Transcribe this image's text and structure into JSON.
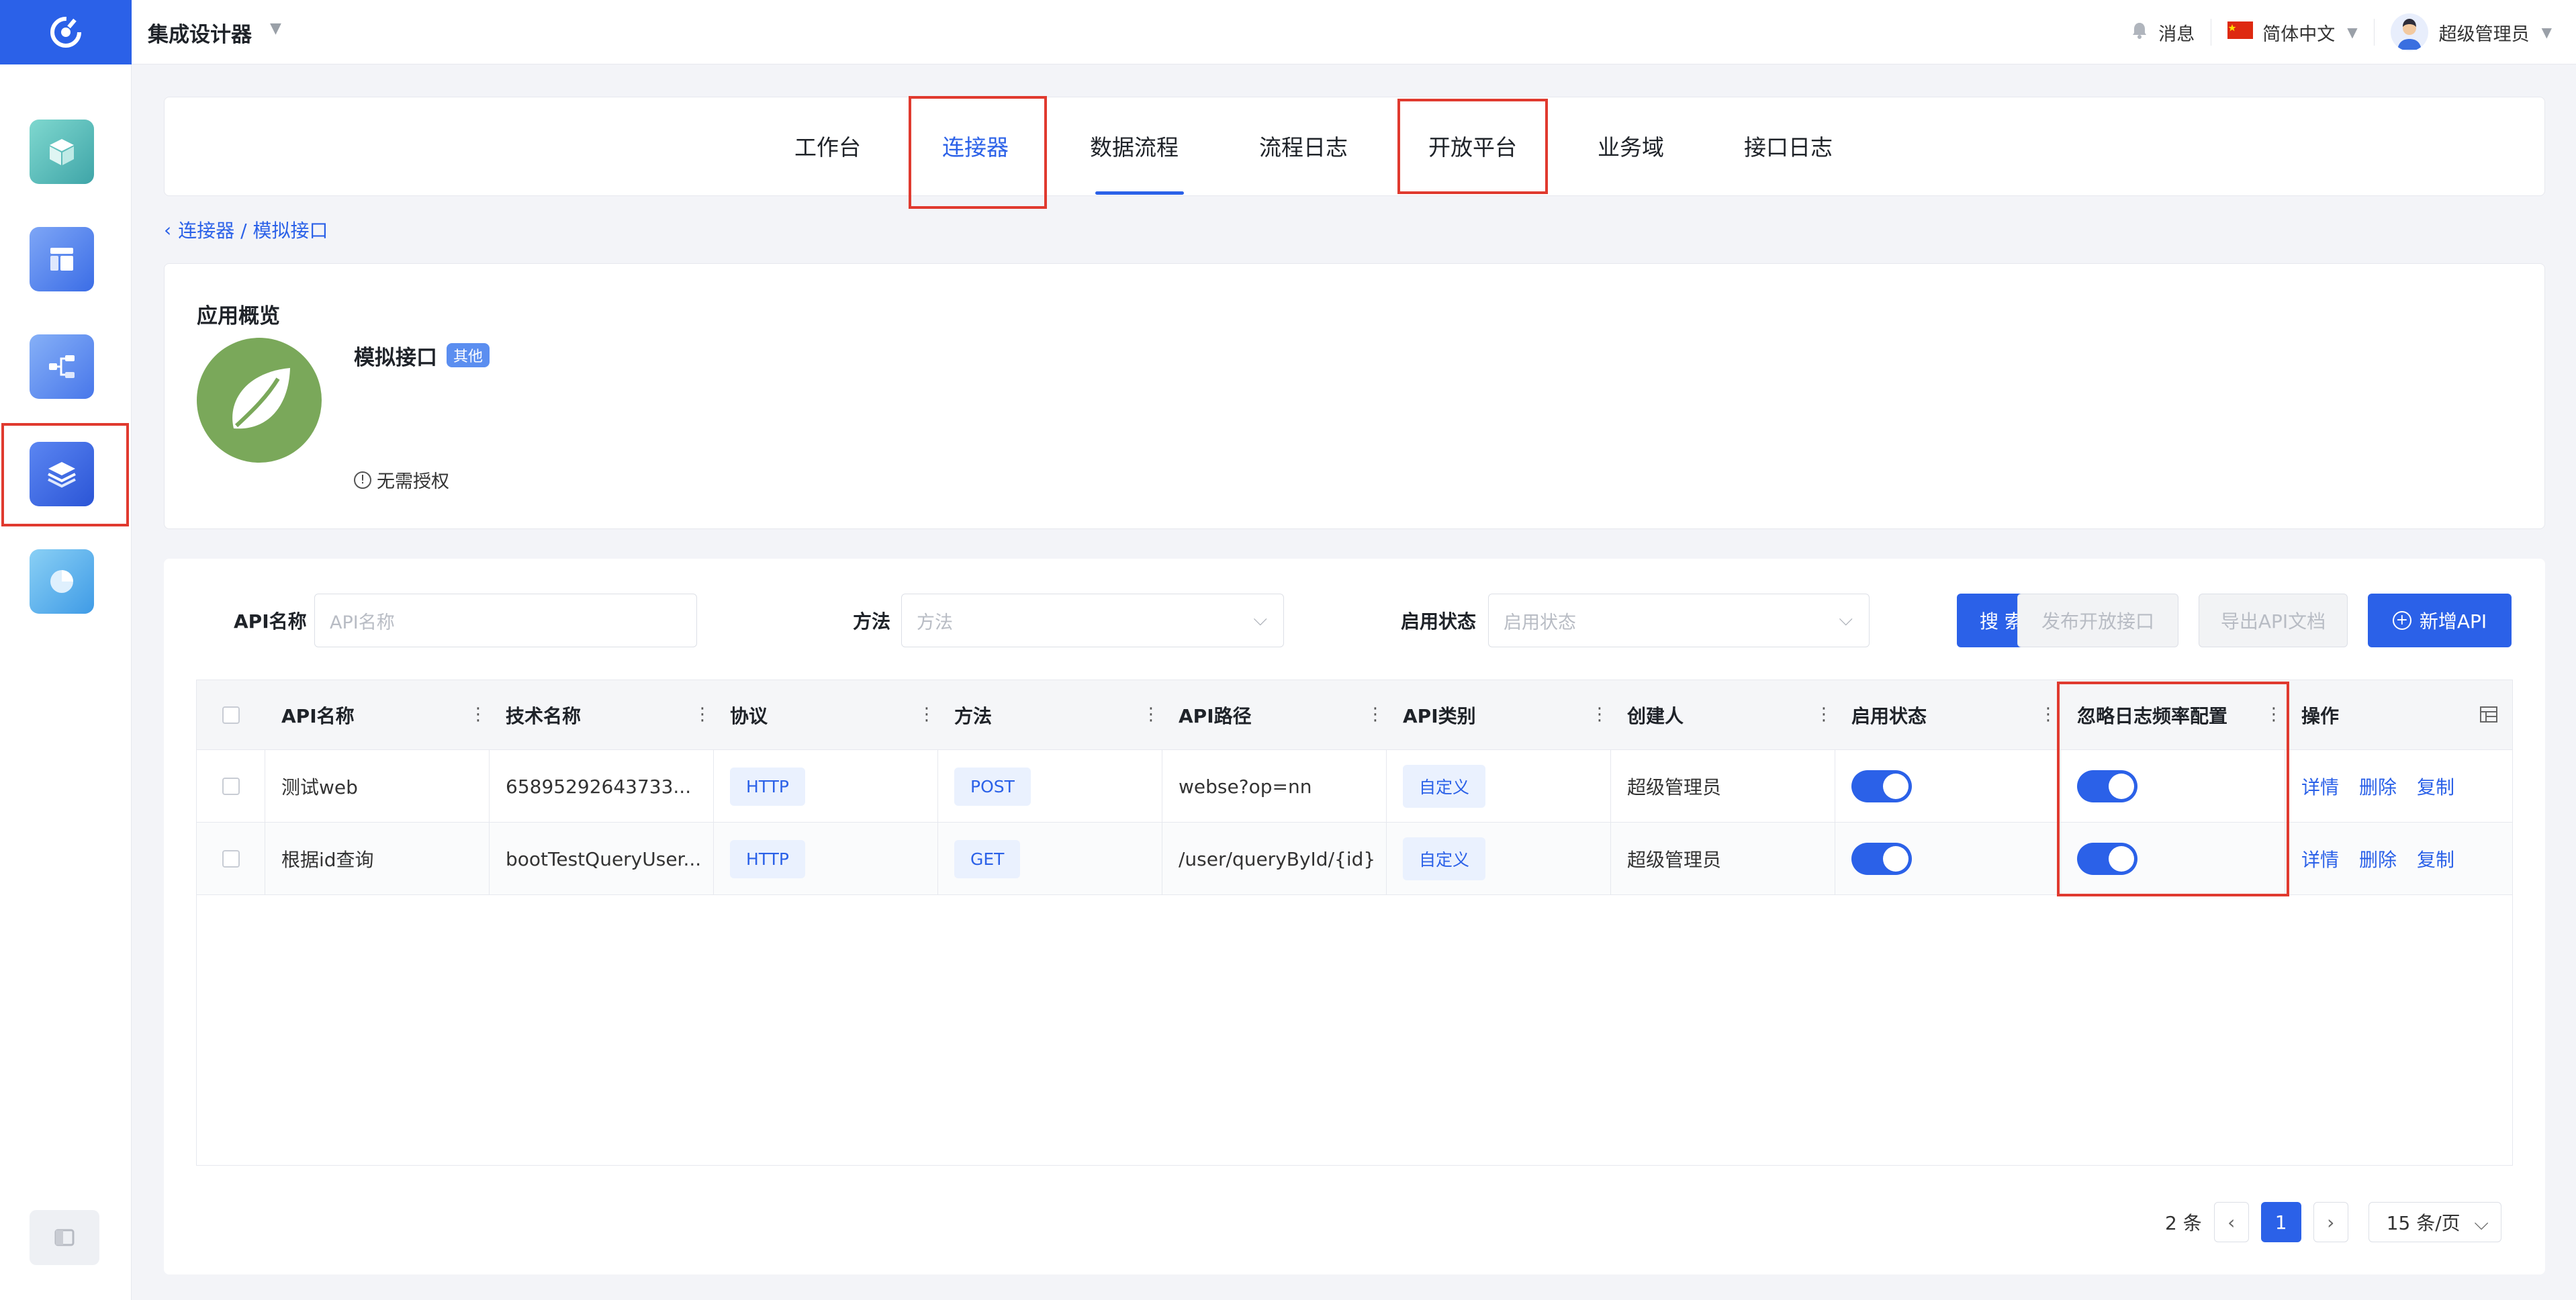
{
  "header": {
    "app_title": "集成设计器",
    "messages_label": "消息",
    "language_label": "简体中文",
    "user_name": "超级管理员"
  },
  "sidebar": {
    "items": [
      {
        "icon": "cube-icon",
        "active": false
      },
      {
        "icon": "layout-icon",
        "active": false
      },
      {
        "icon": "flow-icon",
        "active": false
      },
      {
        "icon": "layers-icon",
        "active": true
      },
      {
        "icon": "pie-chart-icon",
        "active": false
      }
    ]
  },
  "tabs": [
    {
      "label": "工作台"
    },
    {
      "label": "连接器"
    },
    {
      "label": "数据流程"
    },
    {
      "label": "流程日志"
    },
    {
      "label": "开放平台"
    },
    {
      "label": "业务域"
    },
    {
      "label": "接口日志"
    }
  ],
  "active_tab": "连接器",
  "breadcrumb": {
    "text": "连接器 / 模拟接口"
  },
  "overview": {
    "title": "应用概览",
    "app_name": "模拟接口",
    "tag": "其他",
    "auth": "无需授权"
  },
  "filters": {
    "api_name_label": "API名称",
    "api_name_placeholder": "API名称",
    "method_label": "方法",
    "method_placeholder": "方法",
    "status_label": "启用状态",
    "status_placeholder": "启用状态"
  },
  "buttons": {
    "search": "搜 索",
    "publish": "发布开放接口",
    "export": "导出API文档",
    "add": "新增API"
  },
  "table": {
    "headers": [
      "API名称",
      "技术名称",
      "协议",
      "方法",
      "API路径",
      "API类别",
      "创建人",
      "启用状态",
      "忽略日志频率配置",
      "操作"
    ],
    "rows": [
      {
        "name": "测试web",
        "tech": "65895292643733...",
        "protocol": "HTTP",
        "method": "POST",
        "path": "webse?op=nn",
        "category": "自定义",
        "creator": "超级管理员",
        "enabled": true,
        "ignore_log": true
      },
      {
        "name": "根据id查询",
        "tech": "bootTestQueryUser...",
        "protocol": "HTTP",
        "method": "GET",
        "path": "/user/queryById/{id}",
        "category": "自定义",
        "creator": "超级管理员",
        "enabled": true,
        "ignore_log": true
      }
    ],
    "actions": [
      "详情",
      "删除",
      "复制"
    ]
  },
  "pagination": {
    "total": "2 条",
    "current": "1",
    "page_size": "15 条/页"
  },
  "colors": {
    "primary": "#2b61e8",
    "highlight": "#e03a2f"
  }
}
